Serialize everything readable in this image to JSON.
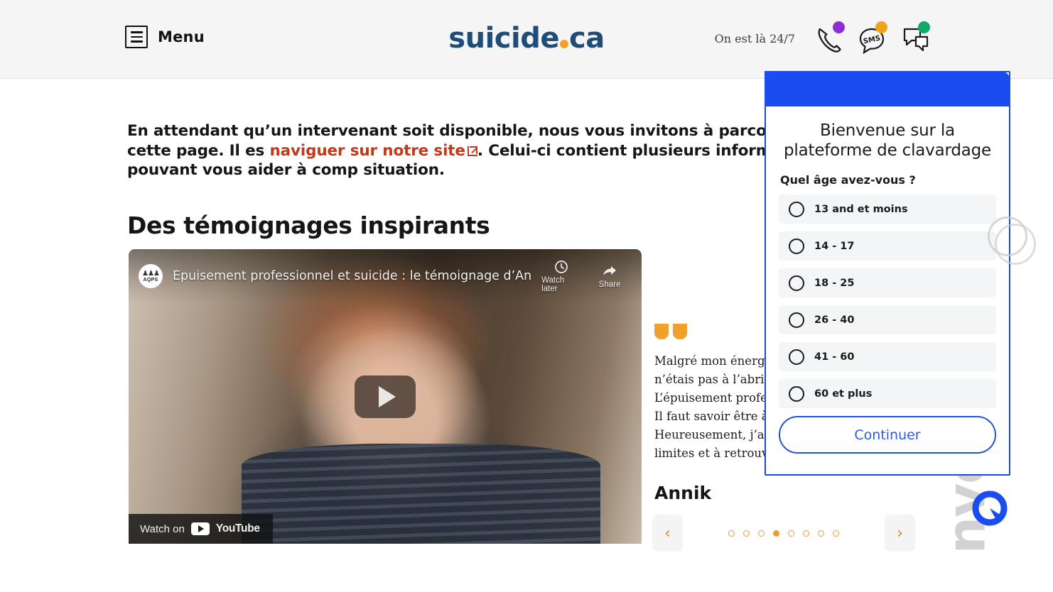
{
  "header": {
    "menu_label": "Menu",
    "menu_icon": "hamburger-menu-icon",
    "brand_name_part1": "suicide",
    "brand_name_part2": "ca",
    "availability_text": "On est là 24/7",
    "contact_icons": [
      {
        "name": "phone-icon",
        "badge_color": "#8b2fd4"
      },
      {
        "name": "sms-icon",
        "label": "SMS",
        "badge_color": "#f2a31c"
      },
      {
        "name": "chat-bubbles-icon",
        "badge_color": "#0fa968"
      }
    ]
  },
  "main": {
    "intro_text_1": "En attendant qu’un intervenant soit disponible, nous vous invitons à parcourir cette page. Il es",
    "intro_link": "naviguer sur notre site",
    "intro_text_2": ". Celui-ci contient plusieurs informations pouvant vous aider à comp",
    "intro_text_3": "situation.",
    "section_title": "Des témoignages inspirants",
    "video": {
      "channel": "AQPS",
      "title": "Épuisement professionnel et suicide : le témoignage d’Annik",
      "watch_later_label": "Watch later",
      "share_label": "Share",
      "watch_on_label": "Watch on",
      "platform": "YouTube",
      "play_icon": "play-button-icon"
    },
    "testimonial": {
      "quote_line_1": "Malgré mon énergie et",
      "quote_line_2": "n’étais pas à l’abri d’un",
      "quote_line_3": "L’épuisement professio",
      "quote_line_4": "Il faut savoir être à l’éc",
      "quote_line_5": "Heureusement, j’ai réu",
      "quote_line_6": "limites et à retrouver u",
      "author": "Annik"
    },
    "carousel": {
      "prev_label": "‹",
      "next_label": "›",
      "total_dots": 8,
      "active_index": 4,
      "accent_color": "#ea9d2e"
    }
  },
  "chat_widget": {
    "header_color": "#1b4cf0",
    "welcome_line_1": "Bienvenue sur la",
    "welcome_line_2": "plateforme de  clavardage",
    "question": "Quel âge avez-vous ?",
    "options": [
      {
        "label": "13 and et moins",
        "selected": false
      },
      {
        "label": "14 - 17",
        "selected": false
      },
      {
        "label": "18 - 25",
        "selected": false
      },
      {
        "label": "26 - 40",
        "selected": false
      },
      {
        "label": "41 - 60",
        "selected": false
      },
      {
        "label": "60 et plus",
        "selected": false
      }
    ],
    "continue_label": "Continuer",
    "spinner_icon": "loading-spinner-icon"
  },
  "branding": {
    "watermark_text": "nventive",
    "logo_icon": "oventive-logo-icon",
    "logo_color": "#1b4cf0"
  }
}
